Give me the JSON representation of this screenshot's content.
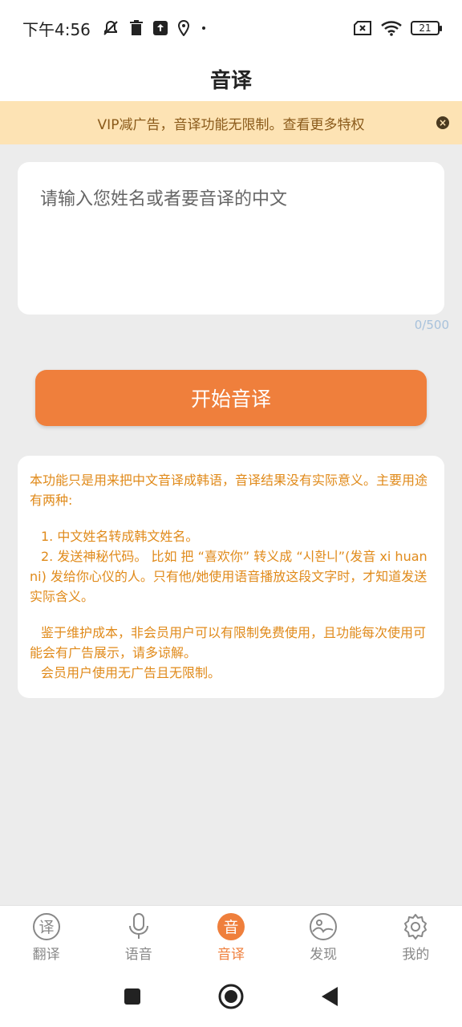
{
  "status_bar": {
    "time": "下午4:56",
    "battery": "21"
  },
  "header": {
    "title": "音译"
  },
  "banner": {
    "text": "VIP减广告，音译功能无限制。查看更多特权",
    "close_label": "×"
  },
  "input": {
    "placeholder": "请输入您姓名或者要音译的中文",
    "value": "",
    "counter": "0/500"
  },
  "action": {
    "start_label": "开始音译"
  },
  "info": {
    "p1": "本功能只是用来把中文音译成韩语，音译结果没有实际意义。主要用途有两种:",
    "item1": "1. 中文姓名转成韩文姓名。",
    "item2": "2. 发送神秘代码。 比如 把 “喜欢你” 转义成 “시환니”(发音 xi huan ni) 发给你心仪的人。只有他/她使用语音播放这段文字时，才知道发送实际含义。",
    "p2": "鉴于维护成本，非会员用户可以有限制免费使用，且功能每次使用可能会有广告展示，请多谅解。",
    "p3": "会员用户使用无广告且无限制。"
  },
  "bottom_nav": {
    "items": [
      {
        "label": "翻译",
        "icon": "translate-icon",
        "glyph": "译"
      },
      {
        "label": "语音",
        "icon": "microphone-icon"
      },
      {
        "label": "音译",
        "icon": "transliterate-icon",
        "glyph": "音",
        "active": true
      },
      {
        "label": "发现",
        "icon": "discover-icon"
      },
      {
        "label": "我的",
        "icon": "settings-gear-icon"
      }
    ]
  },
  "colors": {
    "accent": "#ef7f3c",
    "banner_bg": "#fde3b4",
    "info_text": "#e08a1a",
    "background": "#ececec"
  }
}
